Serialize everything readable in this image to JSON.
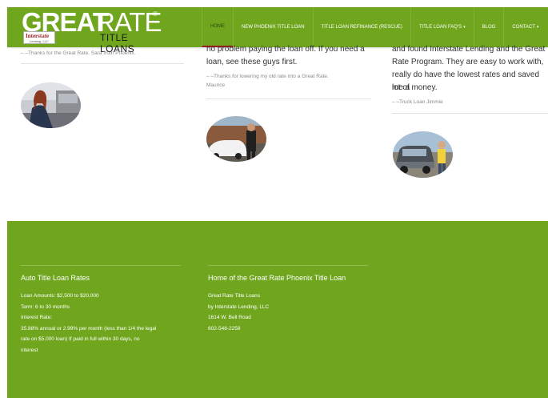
{
  "brand": {
    "logo_main": "GREAT",
    "logo_rate": "RATE",
    "logo_reg": "®",
    "logo_sub": "TITLE LOANS",
    "badge_name": "Interstate",
    "badge_sub": "Lending, LLC"
  },
  "nav": {
    "items": [
      {
        "label": "HOME"
      },
      {
        "label": "NEW PHOENIX TITLE LOAN"
      },
      {
        "label": "TITLE LOAN REFINANCE (RESCUE)"
      },
      {
        "label": "TITLE LOAN FAQ'S"
      },
      {
        "label": "BLOG"
      },
      {
        "label": "CONTACT"
      }
    ],
    "caret": "▾"
  },
  "testimonials": {
    "col1": {
      "signature": "– –Thanks for the Great Rate. Sara from Phoenix."
    },
    "col2": {
      "line1": "no problem paying the loan off. If you need a",
      "line2": "loan, see these guys first.",
      "signature1": "– –Thanks for lowering my old rate into a Great Rate.",
      "signature2": "Maurice"
    },
    "col3": {
      "line1": "and found Interstate Lending and the Great",
      "line2": "Rate Program.  They are easy to work with,",
      "line3": "really do have the lowest rates and saved me a",
      "line4": "lot of money.",
      "signature": "– –Truck Loan Jimmie"
    }
  },
  "footer": {
    "left": {
      "heading": "Auto Title Loan Rates",
      "lines": [
        "Loan Amounts: $2,500 to $20,000",
        "Term: 6 to 30 months",
        "Interest Rate:",
        "35.88% annual or 2.99% per month (less than 1/4 the legal",
        "rate on $5,000 loan) If paid in full within 30 days, no",
        "interest"
      ]
    },
    "right": {
      "heading": "Home of the Great Rate Phoenix Title Loan",
      "lines": [
        "Great Rate Title Loans",
        "by Interstate Lending, LLC",
        "1614 W. Bell Road",
        "602-548-2258"
      ]
    }
  },
  "colors": {
    "brand_green": "#6fa61e",
    "active_underline": "#9b1d1d"
  }
}
